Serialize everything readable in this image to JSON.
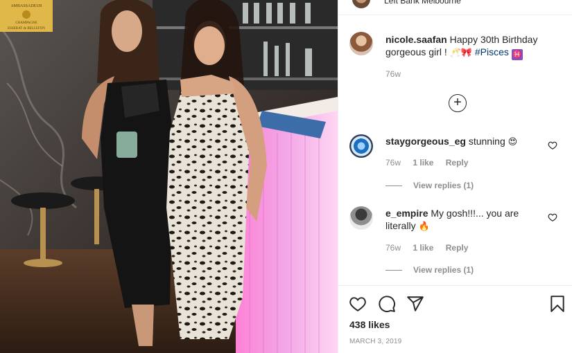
{
  "header": {
    "location": "Left Bank Melbourne"
  },
  "photo": {
    "sign_line1": "AMBASSADEUR",
    "sign_line2": "CHAMPAGNE",
    "sign_line3": "ESSERAT de BELLEFON"
  },
  "caption": {
    "username": "nicole.saafan",
    "text": "Happy 30th Birthday gorgeous girl !",
    "emoji": "🥂🎀",
    "hashtag": "#Pisces",
    "symbol": "♓",
    "age": "76w"
  },
  "load_more": {
    "icon": "plus-circle-icon"
  },
  "comments": [
    {
      "username": "staygorgeous_eg",
      "text": "stunning",
      "emoji": "😍",
      "age": "76w",
      "likes": "1 like",
      "reply": "Reply",
      "view_replies": "View replies (1)"
    },
    {
      "username": "e_empire",
      "text": "My gosh!!!... you are literally",
      "emoji": "🔥",
      "age": "76w",
      "likes": "1 like",
      "reply": "Reply",
      "view_replies": "View replies (1)"
    }
  ],
  "actions": {
    "like_icon": "heart-icon",
    "comment_icon": "comment-icon",
    "share_icon": "paper-plane-icon",
    "save_icon": "bookmark-icon"
  },
  "likes": "438 likes",
  "date": "MARCH 3, 2019"
}
